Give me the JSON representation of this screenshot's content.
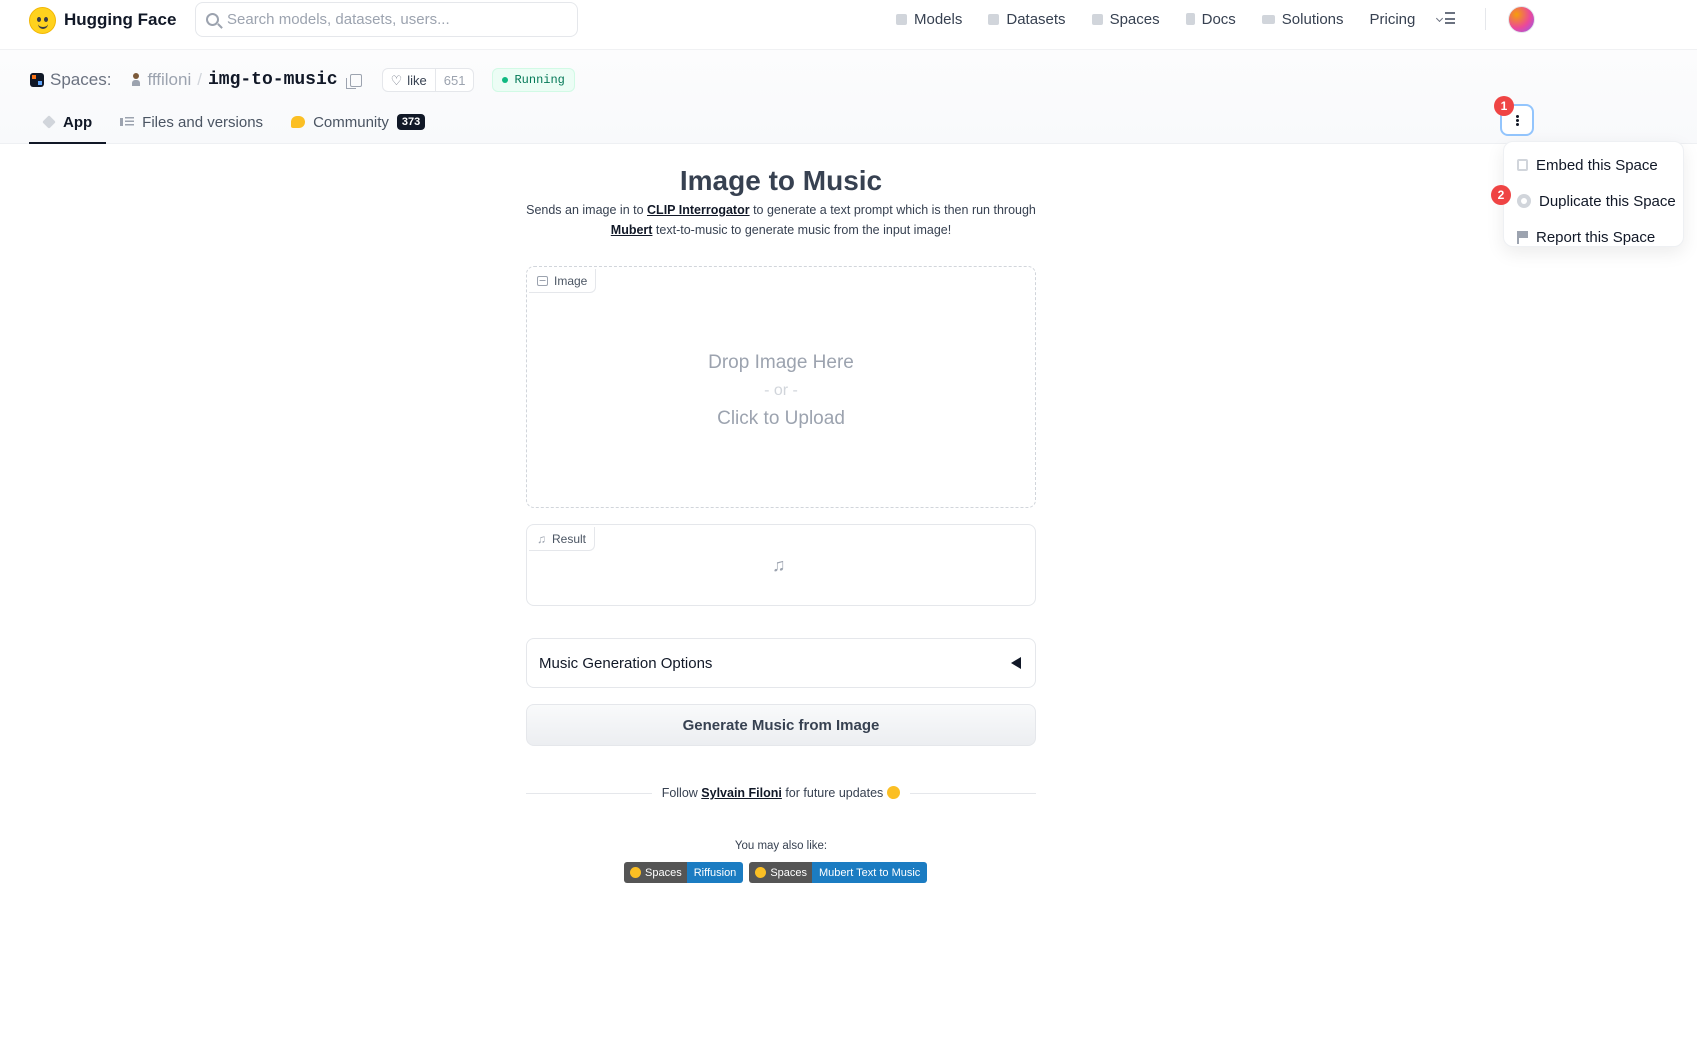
{
  "nav": {
    "brand": "Hugging Face",
    "search_placeholder": "Search models, datasets, users...",
    "links": [
      "Models",
      "Datasets",
      "Spaces",
      "Docs",
      "Solutions",
      "Pricing"
    ]
  },
  "space": {
    "section": "Spaces:",
    "owner": "fffiloni",
    "separator": "/",
    "repo": "img-to-music",
    "like_label": "like",
    "like_count": "651",
    "status": "Running",
    "tabs": [
      {
        "label": "App",
        "active": true
      },
      {
        "label": "Files and versions",
        "active": false
      },
      {
        "label": "Community",
        "active": false,
        "count": "373"
      }
    ]
  },
  "menu": {
    "marker_1": "1",
    "marker_2": "2",
    "items": [
      "Embed this Space",
      "Duplicate this Space",
      "Report this Space"
    ]
  },
  "app": {
    "title": "Image to Music",
    "desc_1": "Sends an image in to ",
    "desc_link_1": "CLIP Interrogator",
    "desc_2": " to generate a text prompt which is then run through ",
    "desc_link_2": "Mubert",
    "desc_3": " text-to-music to generate music from the input image!",
    "image_label": "Image",
    "drop_line_1": "Drop Image Here",
    "drop_line_2": "- or -",
    "drop_line_3": "Click to Upload",
    "result_label": "Result",
    "options_label": "Music Generation Options",
    "generate_button": "Generate Music from Image",
    "follow_pre": "Follow ",
    "follow_link": "Sylvain Filoni",
    "follow_post": " for future updates",
    "also_like": "You may also like:",
    "badges": [
      {
        "left": "Spaces",
        "right": "Riffusion"
      },
      {
        "left": "Spaces",
        "right": "Mubert Text to Music"
      }
    ]
  }
}
